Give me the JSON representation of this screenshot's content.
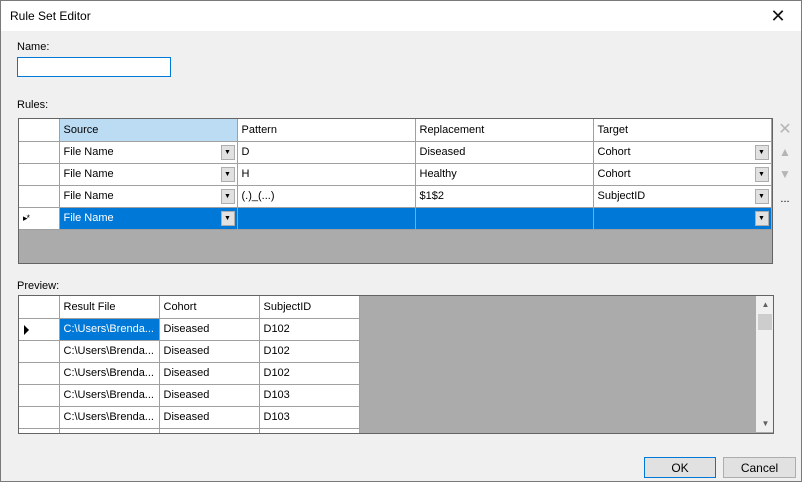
{
  "window": {
    "title": "Rule Set Editor"
  },
  "name_field": {
    "label": "Name:",
    "value": ""
  },
  "rules": {
    "label": "Rules:",
    "columns": [
      "Source",
      "Pattern",
      "Replacement",
      "Target"
    ],
    "rows": [
      [
        "File Name",
        "D",
        "Diseased",
        "Cohort"
      ],
      [
        "File Name",
        "H",
        "Healthy",
        "Cohort"
      ],
      [
        "File Name",
        "(.)_(...)",
        "$1$2",
        "SubjectID"
      ],
      [
        "File Name",
        "",
        "",
        ""
      ]
    ],
    "new_row_indicator": "▸*"
  },
  "side_buttons": {
    "delete": "✕",
    "up": "▲",
    "down": "▼",
    "more": "..."
  },
  "preview": {
    "label": "Preview:",
    "columns": [
      "Result File",
      "Cohort",
      "SubjectID"
    ],
    "rows": [
      [
        "C:\\Users\\Brenda...",
        "Diseased",
        "D102"
      ],
      [
        "C:\\Users\\Brenda...",
        "Diseased",
        "D102"
      ],
      [
        "C:\\Users\\Brenda...",
        "Diseased",
        "D102"
      ],
      [
        "C:\\Users\\Brenda...",
        "Diseased",
        "D103"
      ],
      [
        "C:\\Users\\Brenda...",
        "Diseased",
        "D103"
      ],
      [
        "",
        "",
        ""
      ]
    ]
  },
  "buttons": {
    "ok": "OK",
    "cancel": "Cancel"
  },
  "colors": {
    "selection": "#0078d7",
    "header_selected": "#bcdcf4",
    "grid_empty": "#ababab"
  }
}
